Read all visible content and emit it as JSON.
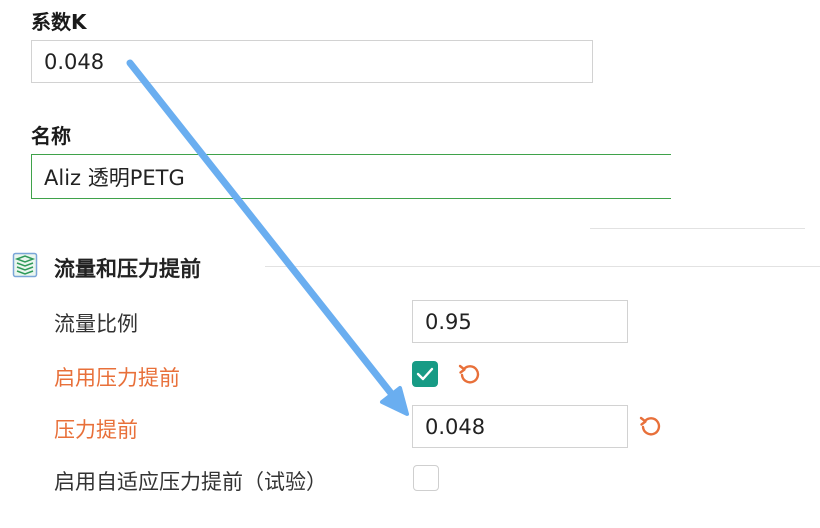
{
  "coefficient_k": {
    "label": "系数K",
    "value": "0.048"
  },
  "name_field": {
    "label": "名称",
    "value": "Aliz 透明PETG"
  },
  "section": {
    "icon": "layers-icon",
    "title": "流量和压力提前"
  },
  "rows": {
    "flow_ratio": {
      "label": "流量比例",
      "value": "0.95"
    },
    "enable_pressure_advance": {
      "label": "启用压力提前",
      "checked": true
    },
    "pressure_advance": {
      "label": "压力提前",
      "value": "0.048"
    },
    "adaptive_pressure_advance": {
      "label": "启用自适应压力提前（试验）",
      "checked": false
    }
  },
  "colors": {
    "modified_label": "#e8703a",
    "checkbox_checked": "#179b85",
    "focus_border": "#3fa24a",
    "annotation_arrow": "#6aaef0"
  }
}
